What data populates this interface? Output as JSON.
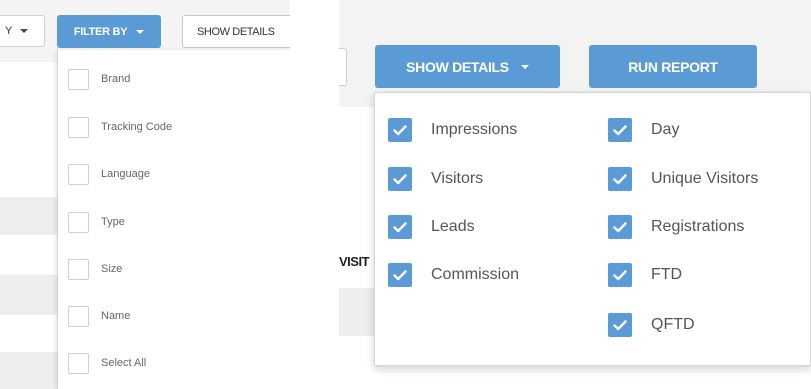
{
  "left_panel": {
    "cut_dropdown_text": "Y",
    "filter_button": {
      "label": "FILTER BY"
    },
    "show_details_cut": "SHOW DETAILS",
    "filter_items": [
      {
        "label": "Brand",
        "checked": false
      },
      {
        "label": "Tracking Code",
        "checked": false
      },
      {
        "label": "Language",
        "checked": false
      },
      {
        "label": "Type",
        "checked": false
      },
      {
        "label": "Size",
        "checked": false
      },
      {
        "label": "Name",
        "checked": false
      },
      {
        "label": "Select All",
        "checked": false
      }
    ]
  },
  "right_panel": {
    "show_details_button": {
      "label": "SHOW DETAILS"
    },
    "run_report_button": {
      "label": "RUN REPORT"
    },
    "column_header_fragment": "VISIT",
    "details_items_left": [
      {
        "label": "Impressions",
        "checked": true
      },
      {
        "label": "Visitors",
        "checked": true
      },
      {
        "label": "Leads",
        "checked": true
      },
      {
        "label": "Commission",
        "checked": true
      }
    ],
    "details_items_right": [
      {
        "label": "Day",
        "checked": true
      },
      {
        "label": "Unique Visitors",
        "checked": true
      },
      {
        "label": "Registrations",
        "checked": true
      },
      {
        "label": "FTD",
        "checked": true
      },
      {
        "label": "QFTD",
        "checked": true
      }
    ]
  },
  "colors": {
    "accent": "#5b9bd5",
    "panel_bg": "#f3f3f3",
    "row_bg": "#eeeeee"
  }
}
